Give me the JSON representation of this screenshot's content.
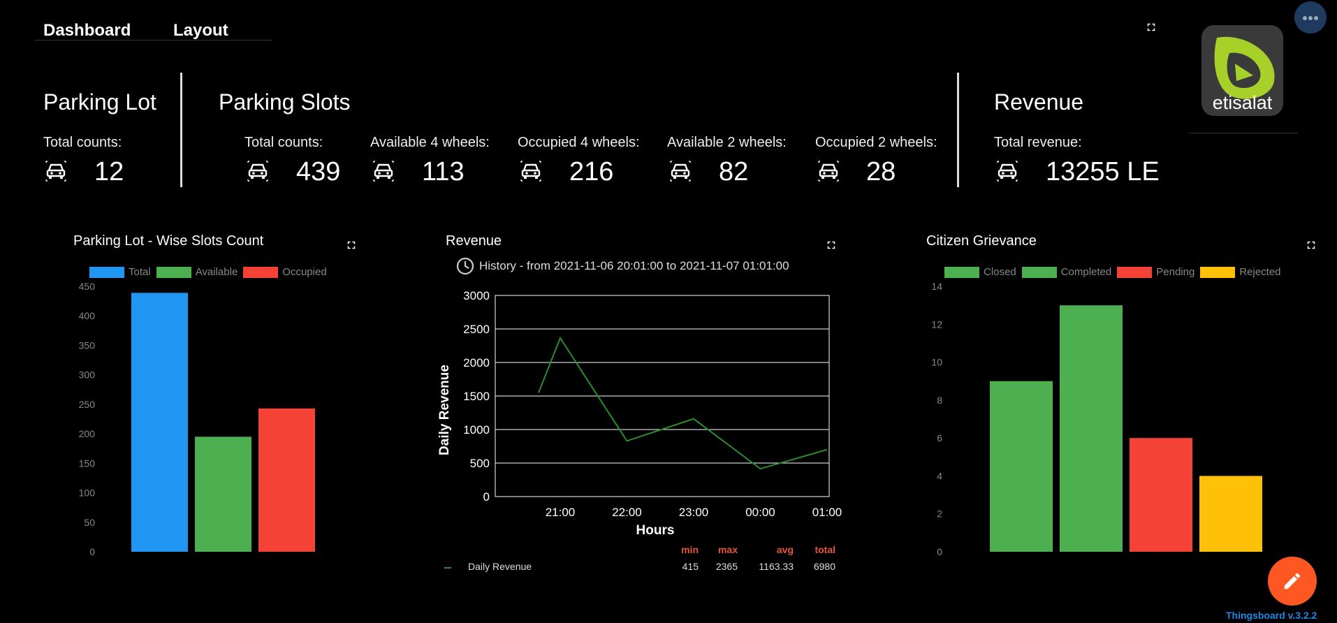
{
  "tabs": [
    "Dashboard",
    "Layout"
  ],
  "parking_lot": {
    "title": "Parking Lot",
    "label": "Total counts:",
    "value": "12"
  },
  "parking_slots": {
    "title": "Parking Slots",
    "stats": [
      {
        "label": "Total counts:",
        "value": "439"
      },
      {
        "label": "Available 4 wheels:",
        "value": "113"
      },
      {
        "label": "Occupied 4 wheels:",
        "value": "216"
      },
      {
        "label": "Available 2 wheels:",
        "value": "82"
      },
      {
        "label": "Occupied 2 wheels:",
        "value": "28"
      }
    ]
  },
  "revenue": {
    "title": "Revenue",
    "label": "Total revenue:",
    "value": "13255 LE"
  },
  "logo": {
    "text": "etisalat"
  },
  "cards": {
    "slots": {
      "title": "Parking Lot - Wise Slots Count"
    },
    "revenue": {
      "title": "Revenue",
      "history": "History - from 2021-11-06 20:01:00 to 2021-11-07 01:01:00"
    },
    "grievance": {
      "title": "Citizen Grievance"
    }
  },
  "revenue_stats": {
    "headers": [
      "min",
      "max",
      "avg",
      "total"
    ],
    "series_name": "Daily Revenue",
    "values": [
      "415",
      "2365",
      "1163.33",
      "6980"
    ]
  },
  "footer": {
    "version": "Thingsboard v.3.2.2"
  },
  "colors": {
    "blue": "#2196F3",
    "green": "#4CAF50",
    "red": "#F44336",
    "yellow": "#FFC107",
    "line_green": "#2e8b2e",
    "fab": "#FF5722",
    "version": "#1e88e5"
  },
  "chart_data": [
    {
      "type": "bar",
      "categories": [
        "Total",
        "Available",
        "Occupied"
      ],
      "values": [
        439,
        195,
        243
      ],
      "series": [
        {
          "name": "Total",
          "values": [
            439
          ]
        },
        {
          "name": "Available",
          "values": [
            195
          ]
        },
        {
          "name": "Occupied",
          "values": [
            243
          ]
        }
      ],
      "ylim": [
        0,
        450
      ],
      "yticks": [
        0,
        50,
        100,
        150,
        200,
        250,
        300,
        350,
        400,
        450
      ],
      "legend": "top",
      "grid": false
    },
    {
      "type": "line",
      "x": [
        "20:30",
        "21:00",
        "22:00",
        "23:00",
        "00:00",
        "01:00"
      ],
      "xticks": [
        "21:00",
        "22:00",
        "23:00",
        "00:00",
        "01:00"
      ],
      "series": [
        {
          "name": "Daily Revenue",
          "values": [
            1550,
            2365,
            830,
            1160,
            415,
            700
          ]
        }
      ],
      "xlabel": "Hours",
      "ylabel": "Daily Revenue",
      "ylim": [
        0,
        3000
      ],
      "yticks": [
        0,
        500,
        1000,
        1500,
        2000,
        2500,
        3000
      ],
      "grid": true,
      "legend": "bottom"
    },
    {
      "type": "bar",
      "categories": [
        "Closed",
        "Completed",
        "Pending",
        "Rejected"
      ],
      "values": [
        9,
        13,
        6,
        4
      ],
      "series": [
        {
          "name": "Closed",
          "values": [
            9
          ]
        },
        {
          "name": "Completed",
          "values": [
            13
          ]
        },
        {
          "name": "Pending",
          "values": [
            6
          ]
        },
        {
          "name": "Rejected",
          "values": [
            4
          ]
        }
      ],
      "ylim": [
        0,
        14
      ],
      "yticks": [
        0,
        2,
        4,
        6,
        8,
        10,
        12,
        14
      ],
      "legend": "top",
      "grid": false
    }
  ]
}
